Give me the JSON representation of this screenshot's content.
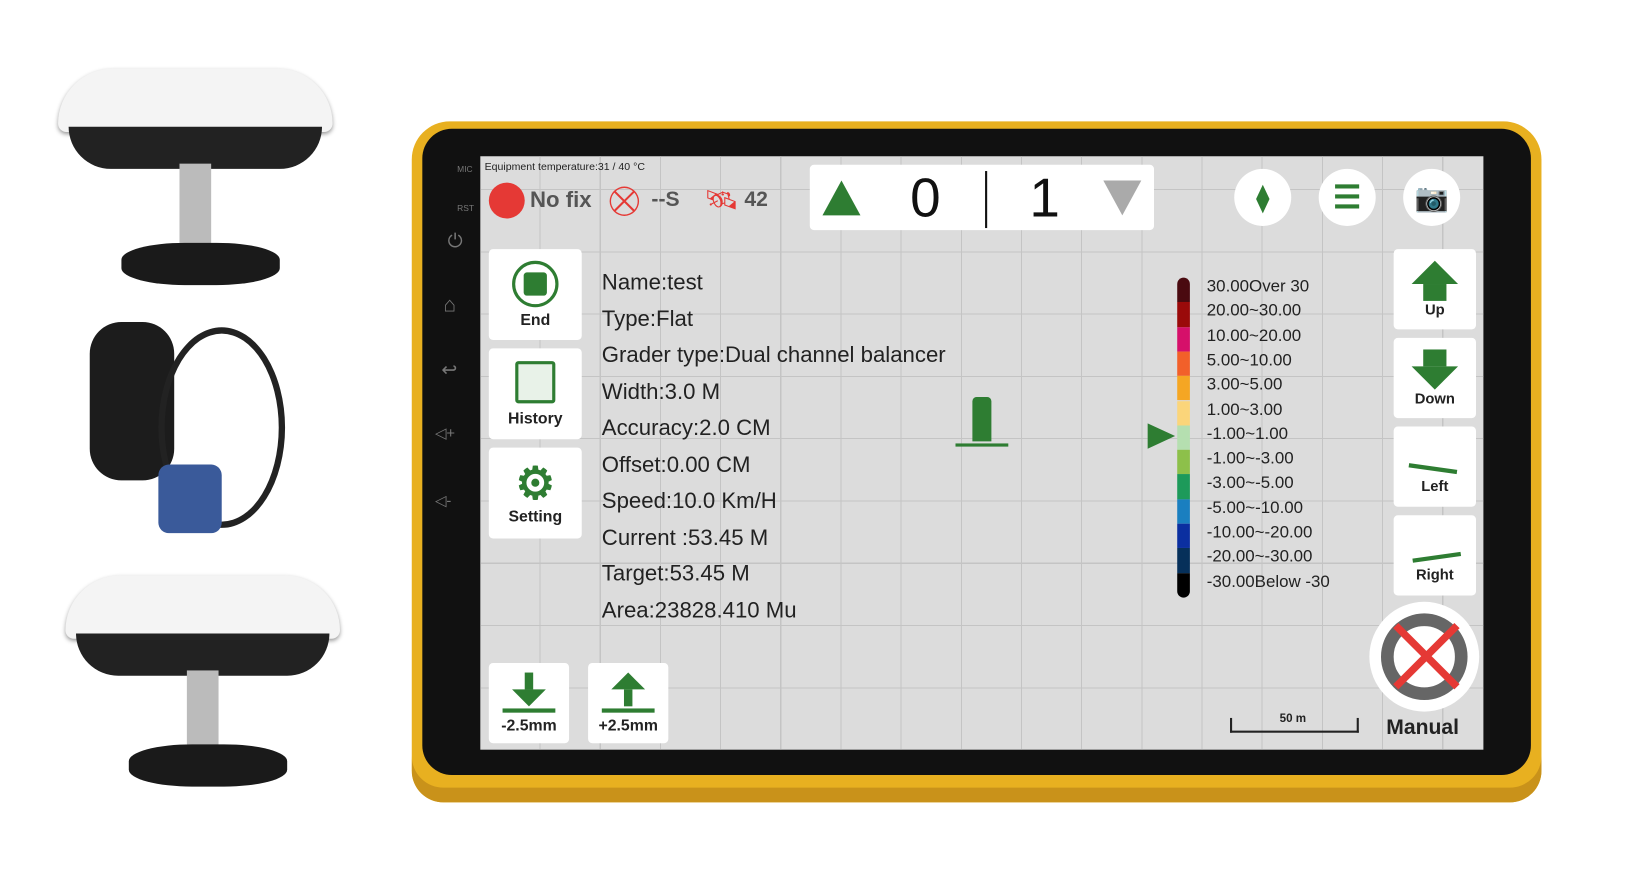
{
  "status": {
    "temperature": "Equipment temperature:31 / 40 °C",
    "fix": "No fix",
    "diff": "--S",
    "satellites": "42"
  },
  "counter": {
    "left": "0",
    "right": "1"
  },
  "side_labels": {
    "mic": "MIC",
    "rst": "RST"
  },
  "left_buttons": [
    {
      "label": "End",
      "icon": "stop-icon"
    },
    {
      "label": "History",
      "icon": "history-icon"
    },
    {
      "label": "Setting",
      "icon": "gear-icon"
    }
  ],
  "info": [
    "Name:test",
    "Type:Flat",
    "Grader type:Dual channel balancer",
    "Width:3.0 M",
    "Accuracy:2.0 CM",
    "Offset:0.00 CM",
    "Speed:10.0 Km/H",
    "Current :53.45 M",
    "Target:53.45 M",
    "Area:23828.410 Mu"
  ],
  "legend": [
    {
      "label": "30.00Over 30",
      "color": "#4a0a10"
    },
    {
      "label": "20.00~30.00",
      "color": "#9a0a0a"
    },
    {
      "label": "10.00~20.00",
      "color": "#d6106a"
    },
    {
      "label": "5.00~10.00",
      "color": "#f2602a"
    },
    {
      "label": "3.00~5.00",
      "color": "#f5a623"
    },
    {
      "label": "1.00~3.00",
      "color": "#fbd57a"
    },
    {
      "label": "-1.00~1.00",
      "color": "#b5dfb0"
    },
    {
      "label": "-1.00~-3.00",
      "color": "#8dc04a"
    },
    {
      "label": "-3.00~-5.00",
      "color": "#1d9a5a"
    },
    {
      "label": "-5.00~-10.00",
      "color": "#1a7fc0"
    },
    {
      "label": "-10.00~-20.00",
      "color": "#0b2fa0"
    },
    {
      "label": "-20.00~-30.00",
      "color": "#06305a"
    },
    {
      "label": "-30.00Below -30",
      "color": "#000000"
    }
  ],
  "legend_indicator": "-1.00~1.00",
  "right_buttons": [
    {
      "label": "Up"
    },
    {
      "label": "Down"
    },
    {
      "label": "Left"
    },
    {
      "label": "Right"
    }
  ],
  "bottom_buttons": [
    {
      "label": "-2.5mm"
    },
    {
      "label": "+2.5mm"
    }
  ],
  "scale": "50 m",
  "mode": "Manual",
  "colors": {
    "accent": "#2e7d32",
    "alert": "#e53935",
    "frame": "#e8b020"
  }
}
